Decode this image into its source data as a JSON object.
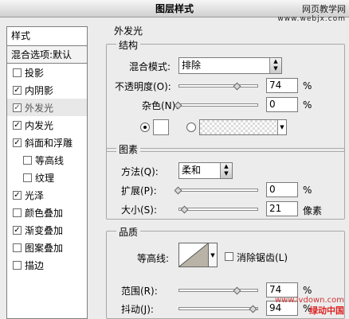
{
  "window": {
    "title": "图层样式"
  },
  "watermark": {
    "line1": "网页教学网",
    "line2": "www.webjx.com"
  },
  "stamp": {
    "line1": "www.lvdown.com",
    "line2": "绿动中国"
  },
  "styles_list": {
    "header": "样式",
    "blend_options": "混合选项:默认",
    "items": [
      {
        "label": "投影",
        "checked": "",
        "sub": false,
        "selected": false
      },
      {
        "label": "内阴影",
        "checked": "✓",
        "sub": false,
        "selected": false
      },
      {
        "label": "外发光",
        "checked": "✓",
        "sub": false,
        "selected": true
      },
      {
        "label": "内发光",
        "checked": "✓",
        "sub": false,
        "selected": false
      },
      {
        "label": "斜面和浮雕",
        "checked": "✓",
        "sub": false,
        "selected": false
      },
      {
        "label": "等高线",
        "checked": "",
        "sub": true,
        "selected": false
      },
      {
        "label": "纹理",
        "checked": "",
        "sub": true,
        "selected": false
      },
      {
        "label": "光泽",
        "checked": "✓",
        "sub": false,
        "selected": false
      },
      {
        "label": "颜色叠加",
        "checked": "",
        "sub": false,
        "selected": false
      },
      {
        "label": "渐变叠加",
        "checked": "✓",
        "sub": false,
        "selected": false
      },
      {
        "label": "图案叠加",
        "checked": "",
        "sub": false,
        "selected": false
      },
      {
        "label": "描边",
        "checked": "",
        "sub": false,
        "selected": false
      }
    ]
  },
  "outer_glow": {
    "title": "外发光",
    "structure": {
      "title": "结构",
      "blend_mode_label": "混合模式:",
      "blend_mode_value": "排除",
      "opacity_label": "不透明度(O):",
      "opacity_value": "74",
      "opacity_unit": "%",
      "opacity_level": 0.74,
      "noise_label": "杂色(N):",
      "noise_value": "0",
      "noise_unit": "%",
      "noise_level": 0
    },
    "elements": {
      "title": "图素",
      "technique_label": "方法(Q):",
      "technique_value": "柔和",
      "spread_label": "扩展(P):",
      "spread_value": "0",
      "spread_unit": "%",
      "spread_level": 0,
      "size_label": "大小(S):",
      "size_value": "21",
      "size_unit": "像素",
      "size_level": 0.084
    },
    "quality": {
      "title": "品质",
      "contour_label": "等高线:",
      "antialias_label": "消除锯齿(L)",
      "antialias_checked": "",
      "range_label": "范围(R):",
      "range_value": "74",
      "range_unit": "%",
      "range_level": 0.74,
      "jitter_label": "抖动(J):",
      "jitter_value": "94",
      "jitter_unit": "%",
      "jitter_level": 0.94
    }
  },
  "colors": {
    "accent": "#000000",
    "panel_bg": "#ececec"
  }
}
